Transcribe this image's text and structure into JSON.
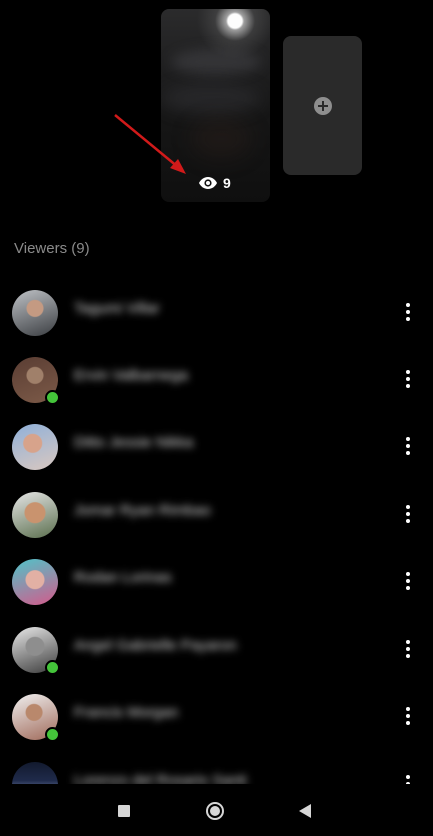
{
  "story": {
    "view_count": "9",
    "eye_icon": "eye-icon",
    "add_icon": "plus-icon"
  },
  "viewers": {
    "header": "Viewers (9)",
    "items": [
      {
        "name": "Tagumi Villar",
        "online": false
      },
      {
        "name": "Ervin Valbarnega",
        "online": true
      },
      {
        "name": "Ditto Jessie Nikka",
        "online": false
      },
      {
        "name": "Jomar Ryan Rimbao",
        "online": false
      },
      {
        "name": "Rodan Lorinas",
        "online": false
      },
      {
        "name": "Angel Gabrielle Payaron",
        "online": true
      },
      {
        "name": "Francis Morgan",
        "online": true
      },
      {
        "name": "Lorenzo del Rosario Santi",
        "online": false
      }
    ]
  },
  "navigation": {
    "recents_icon": "square-icon",
    "home_icon": "circle-icon",
    "back_icon": "triangle-back-icon"
  },
  "colors": {
    "background": "#000000",
    "online": "#44c43a",
    "arrow": "#d11a1a",
    "header_text": "#8a8a8a"
  }
}
